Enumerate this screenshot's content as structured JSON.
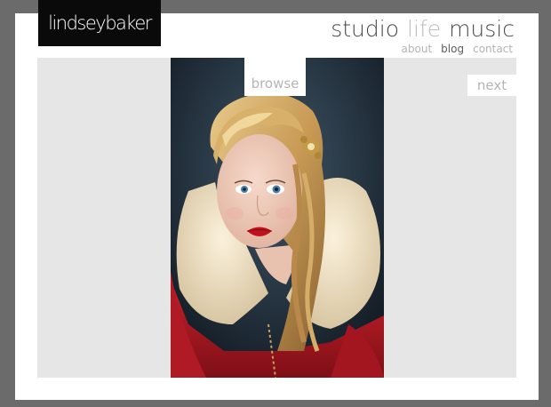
{
  "logo": {
    "text": "lindseybaker"
  },
  "main_nav": {
    "items": [
      {
        "label": "studio",
        "active": false
      },
      {
        "label": "life",
        "active": true
      },
      {
        "label": "music",
        "active": false
      }
    ]
  },
  "sub_nav": {
    "items": [
      {
        "label": "about",
        "active": false
      },
      {
        "label": "blog",
        "active": true
      },
      {
        "label": "contact",
        "active": false
      }
    ]
  },
  "gallery": {
    "browse_label": "browse",
    "next_label": "next"
  },
  "colors": {
    "frame": "#6b6b6b",
    "stage": "#e6e6e6",
    "logo_bg": "#0a0a0a",
    "nav_text": "#4a4a4a",
    "nav_active": "#bdbdbd",
    "button_text": "#b5b5b5"
  }
}
